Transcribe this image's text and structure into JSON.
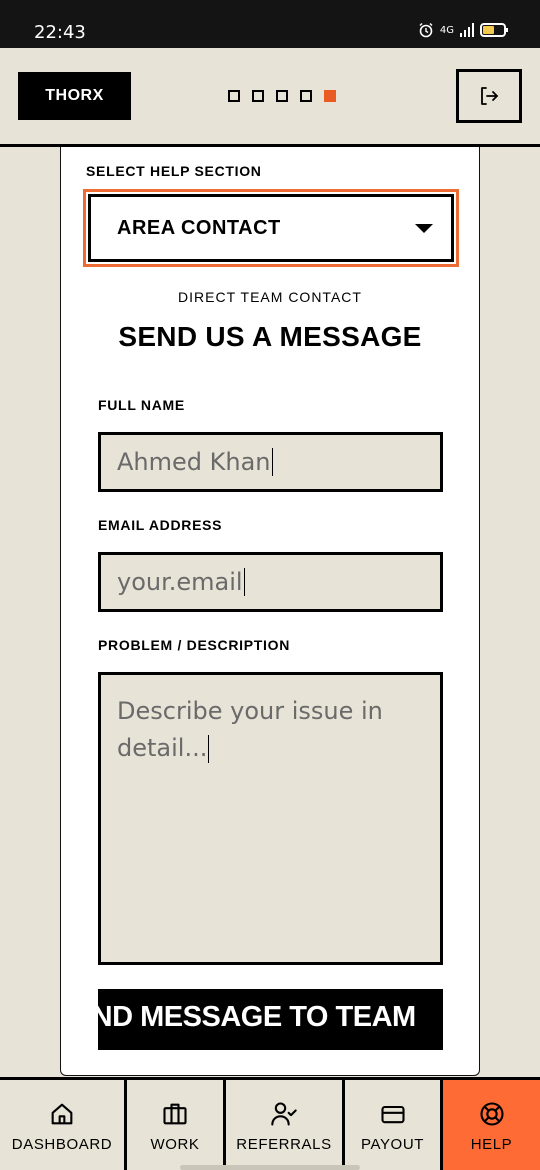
{
  "status_bar": {
    "time": "22:43",
    "network": "4G"
  },
  "header": {
    "logo": "THORX",
    "progress_steps": 5,
    "active_step": 5,
    "logout_icon": "logout-icon"
  },
  "help": {
    "section_label": "SELECT HELP SECTION",
    "selected_section": "AREA CONTACT",
    "sub_heading": "DIRECT TEAM CONTACT",
    "heading": "SEND US A MESSAGE",
    "full_name": {
      "label": "FULL NAME",
      "value": "Ahmed Khan"
    },
    "email": {
      "label": "EMAIL ADDRESS",
      "placeholder": "your.email"
    },
    "problem": {
      "label": "PROBLEM / DESCRIPTION",
      "placeholder": "Describe your issue in detail..."
    },
    "submit_label": "SEND MESSAGE TO TEAM"
  },
  "nav": {
    "items": [
      {
        "label": "DASHBOARD",
        "icon": "home-icon"
      },
      {
        "label": "WORK",
        "icon": "briefcase-icon"
      },
      {
        "label": "REFERRALS",
        "icon": "user-check-icon"
      },
      {
        "label": "PAYOUT",
        "icon": "card-icon"
      },
      {
        "label": "HELP",
        "icon": "lifebuoy-icon"
      }
    ],
    "active": "HELP"
  },
  "colors": {
    "accent": "#ff6b35",
    "background": "#e7e3d6",
    "ink": "#000000"
  }
}
